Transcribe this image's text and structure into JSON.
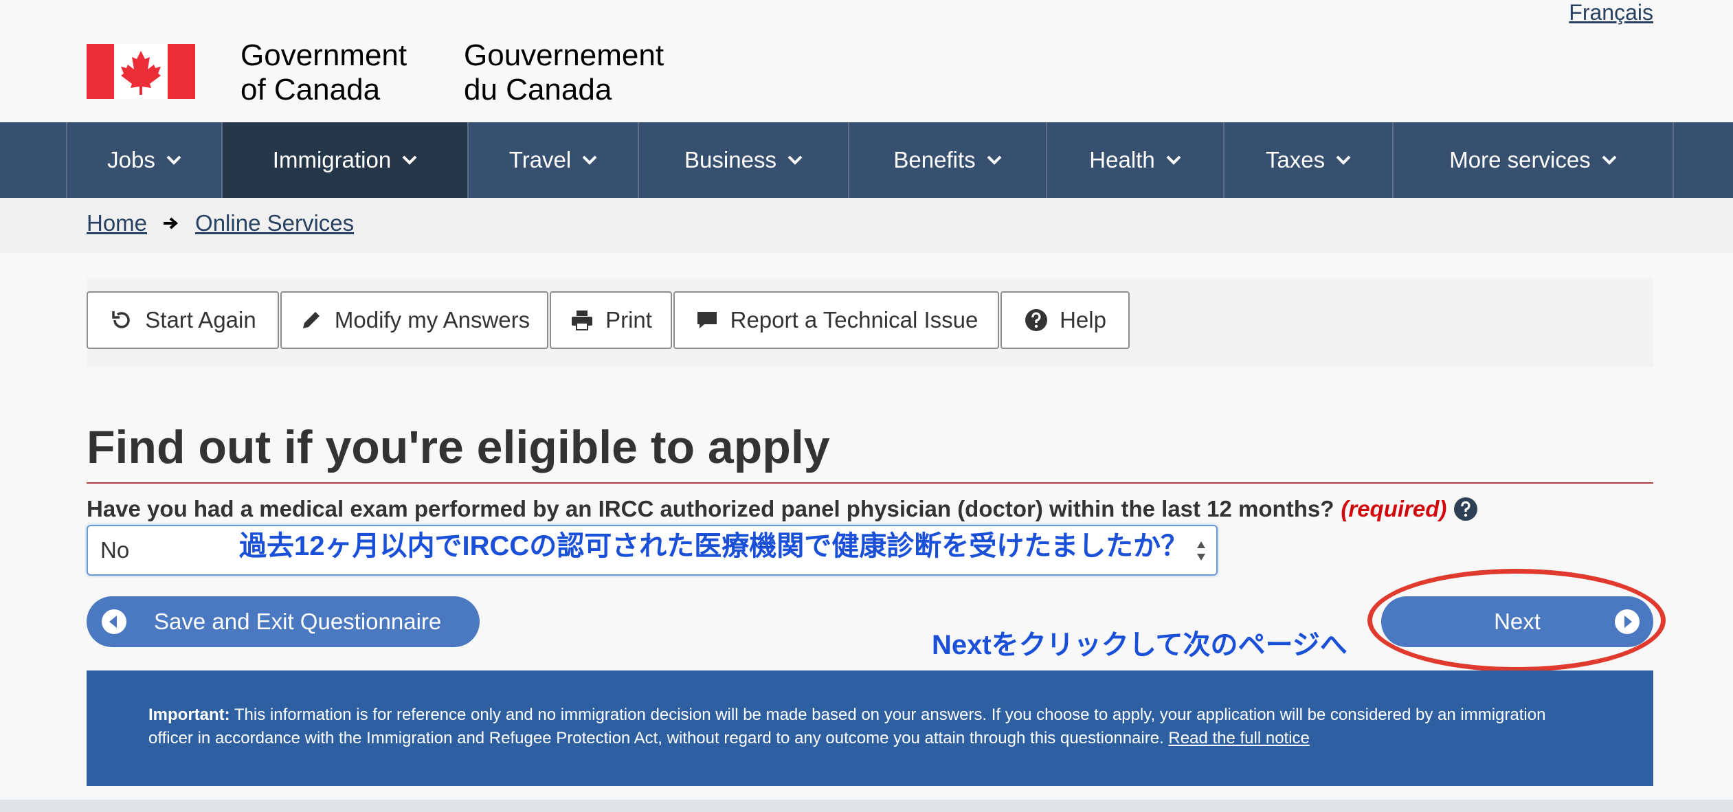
{
  "lang_toggle": "Français",
  "header": {
    "wordmark_en_line1": "Government",
    "wordmark_en_line2": "of Canada",
    "wordmark_fr_line1": "Gouvernement",
    "wordmark_fr_line2": "du Canada"
  },
  "nav": {
    "items": [
      {
        "label": "Jobs"
      },
      {
        "label": "Immigration"
      },
      {
        "label": "Travel"
      },
      {
        "label": "Business"
      },
      {
        "label": "Benefits"
      },
      {
        "label": "Health"
      },
      {
        "label": "Taxes"
      },
      {
        "label": "More services"
      }
    ]
  },
  "breadcrumb": {
    "home": "Home",
    "online_services": "Online Services"
  },
  "toolbar": {
    "start_again": "Start Again",
    "modify_answers": "Modify my Answers",
    "print": "Print",
    "report_issue": "Report a Technical Issue",
    "help": "Help"
  },
  "main": {
    "title": "Find out if you're eligible to apply",
    "question": "Have you had a medical exam performed by an IRCC authorized panel physician (doctor) within the last 12 months?",
    "required_label": "(required)",
    "select_value": "No",
    "save_exit_label": "Save and Exit Questionnaire",
    "next_label": "Next"
  },
  "annotations": {
    "jp_question_note": "過去12ヶ月以内でIRCCの認可された医療機関で健康診断を受けたましたか？",
    "jp_next_note": "Nextをクリックして次のページへ"
  },
  "notice": {
    "important_label": "Important:",
    "text": "This information is for reference only and no immigration decision will be made based on your answers. If you choose to apply, your application will be considered by an immigration officer in accordance with the Immigration and Refugee Protection Act, without regard to any outcome you attain through this questionnaire.",
    "link": "Read the full notice"
  },
  "colors": {
    "nav_bg": "#38506f",
    "nav_active_bg": "#26374a",
    "button_blue": "#4a79c2",
    "notice_bg": "#2e5fa0",
    "required_red": "#d3080c",
    "annotation_blue": "#1a4fd8",
    "annotation_ring": "#e03a2e"
  },
  "icons": {
    "flag": "canada-flag-icon",
    "chevron": "chevron-down-icon",
    "crumb_arrow": "arrow-right-icon",
    "start_again": "refresh-icon",
    "modify": "pencil-icon",
    "print": "print-icon",
    "report": "comment-icon",
    "help": "question-circle-icon",
    "save_exit": "circle-arrow-left-icon",
    "next": "circle-arrow-right-icon"
  }
}
